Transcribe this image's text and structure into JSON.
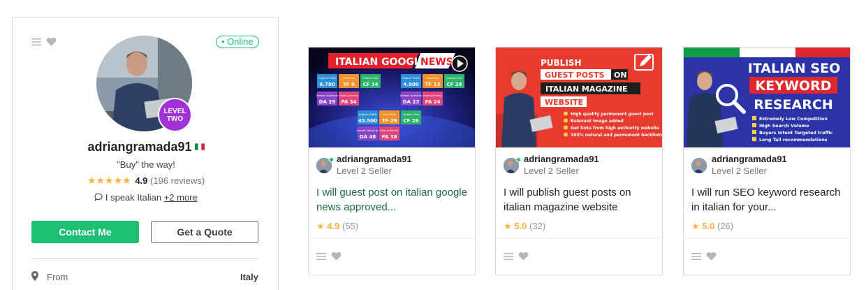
{
  "profile": {
    "online_label": "• Online",
    "level_line1": "LEVEL",
    "level_line2": "TWO",
    "username": "adriangramada91",
    "tagline": "\"Buy\" the way!",
    "stars": "★★★★★",
    "rating": "4.9",
    "reviews": "(196 reviews)",
    "lang_icon": "💬",
    "lang_text": "I speak Italian ",
    "lang_more": "+2 more",
    "contact_label": "Contact Me",
    "quote_label": "Get a Quote",
    "from_label": "From",
    "from_value": "Italy",
    "icons": [
      "menu-icon",
      "heart-icon",
      "italy-flag-icon",
      "chat-bubble-icon",
      "location-pin-icon"
    ]
  },
  "gigs": [
    {
      "seller": "adriangramada91",
      "level": "Level 2 Seller",
      "title": "I will guest post on italian google news approved...",
      "rating": "4.9",
      "count": "(55)",
      "thumb": {
        "headline_a": "ITALIAN GOOGLE",
        "headline_b": "NEWS",
        "metrics": [
          {
            "label": "Organic Traffic",
            "value": "9.700"
          },
          {
            "label": "Trust Flow",
            "value": "TF 9"
          },
          {
            "label": "Citation Flow",
            "value": "CF 34"
          },
          {
            "label": "Organic Traffic",
            "value": "4.900"
          },
          {
            "label": "Trust Flow",
            "value": "TF 13"
          },
          {
            "label": "Citation Flow",
            "value": "CF 29"
          },
          {
            "label": "Domain Authority",
            "value": "DA 29"
          },
          {
            "label": "Page Authority",
            "value": "PA 34"
          },
          {
            "label": "Domain Authority",
            "value": "DA 23"
          },
          {
            "label": "Page Authority",
            "value": "PA 24"
          },
          {
            "label": "Organic Traffic",
            "value": "45.500"
          },
          {
            "label": "Trust Flow",
            "value": "TF 29"
          },
          {
            "label": "Citation Flow",
            "value": "CF 26"
          },
          {
            "label": "Domain Authority",
            "value": "DA 48"
          },
          {
            "label": "Page Authority",
            "value": "PA 38"
          }
        ]
      }
    },
    {
      "seller": "adriangramada91",
      "level": "Level 2 Seller",
      "title": "I will publish guest posts on italian magazine website",
      "rating": "5.0",
      "count": "(32)",
      "thumb": {
        "line1": "PUBLISH",
        "line2a": "GUEST POSTS",
        "line2b": "ON",
        "line3": "ITALIAN MAGAZINE",
        "line4": "WEBSITE",
        "bullets": [
          "High quality permanent guest post",
          "Relevant image added",
          "Get links from high authority website",
          "100% natural and permanent backlinks"
        ]
      }
    },
    {
      "seller": "adriangramada91",
      "level": "Level 2 Seller",
      "title": "I will run SEO keyword research in italian for your...",
      "rating": "5.0",
      "count": "(26)",
      "thumb": {
        "line1": "ITALIAN SEO",
        "line2": "KEYWORD",
        "line3": "RESEARCH",
        "bullets": [
          "Extremely Low Competition",
          "High Search Volume",
          "Buyers Intent Targeted traffic",
          "Long Tail recommendations"
        ]
      }
    }
  ],
  "colors": {
    "brand_green": "#1dbf73",
    "star": "#ffb33e",
    "level_badge": "#a232d6",
    "title_green": "#1e6a3d"
  }
}
